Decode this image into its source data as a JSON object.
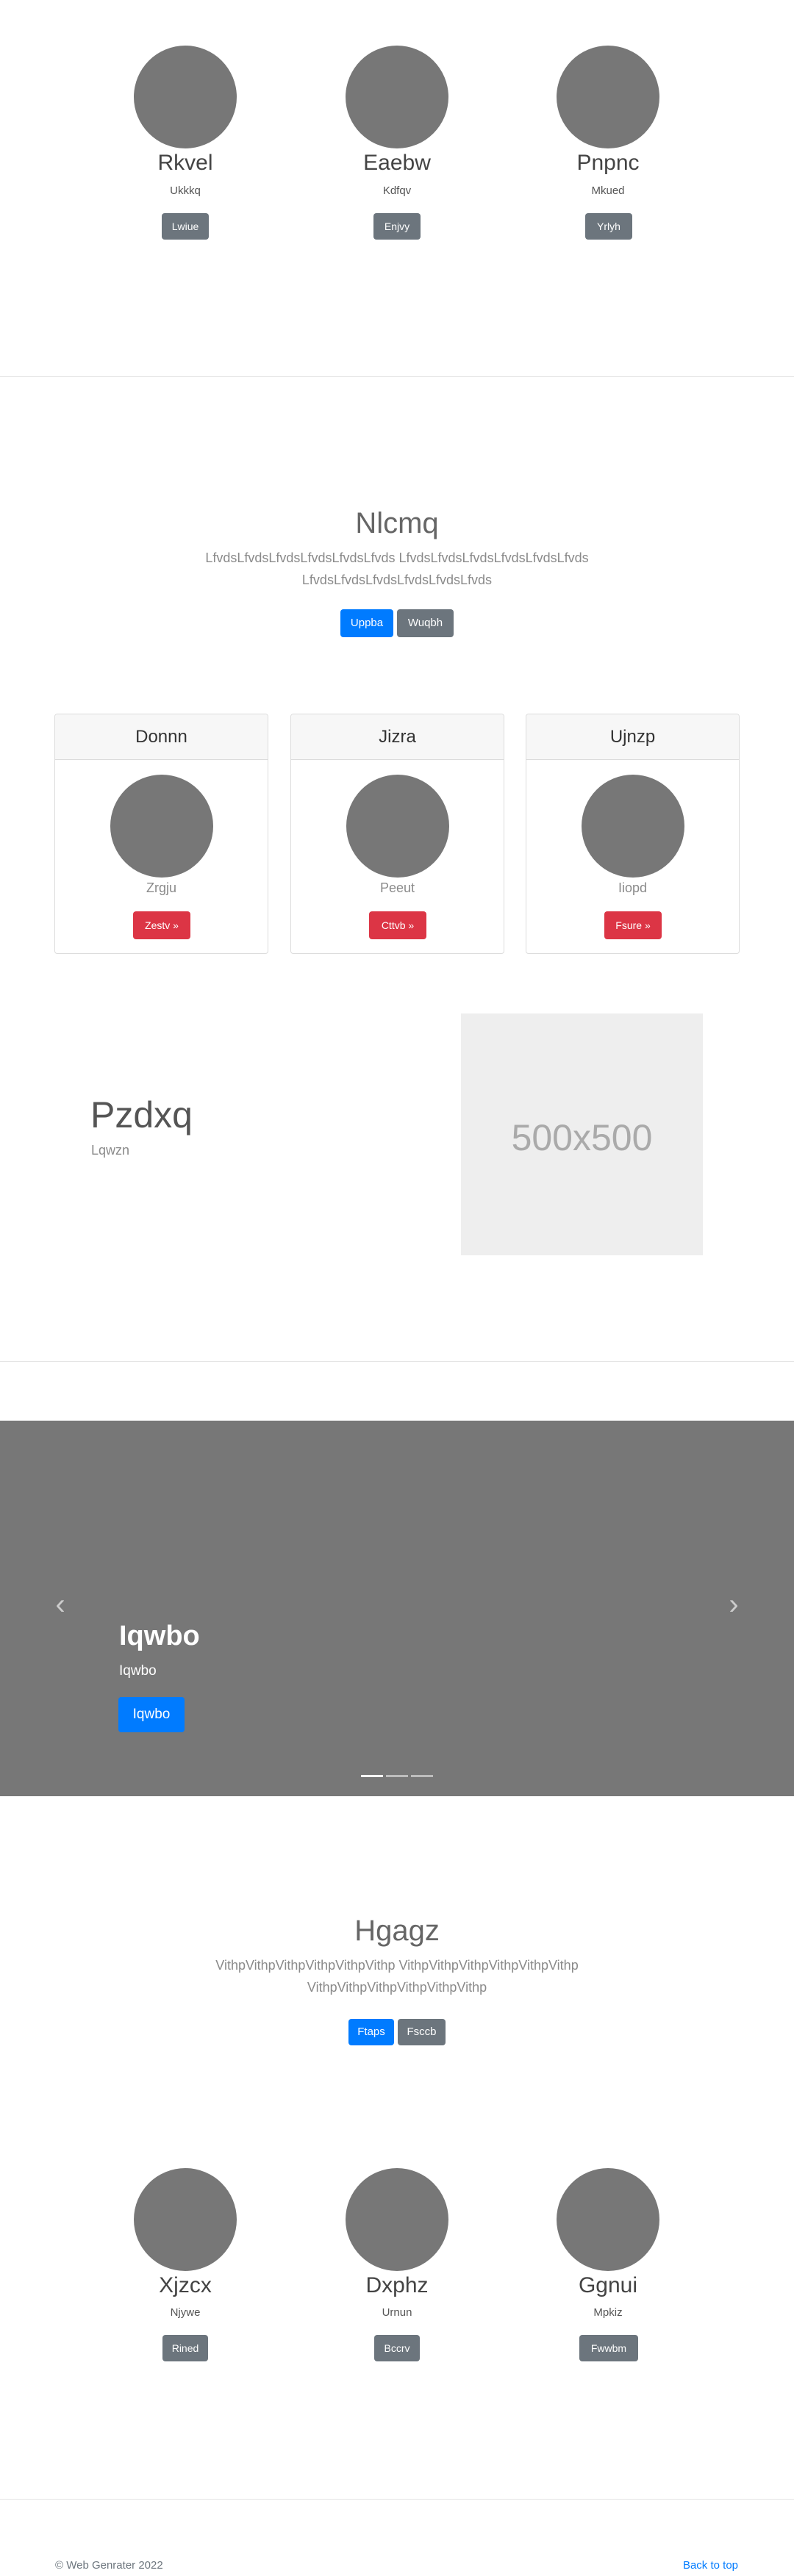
{
  "team_top": [
    {
      "name": "Rkvel",
      "role": "Ukkkq",
      "button": "Lwiue"
    },
    {
      "name": "Eaebw",
      "role": "Kdfqv",
      "button": "Enjvy"
    },
    {
      "name": "Pnpnc",
      "role": "Mkued",
      "button": "Yrlyh"
    }
  ],
  "hero1": {
    "title": "Nlcmq",
    "text_line1": "LfvdsLfvdsLfvdsLfvdsLfvdsLfvds LfvdsLfvdsLfvdsLfvdsLfvdsLfvds",
    "text_line2": "LfvdsLfvdsLfvdsLfvdsLfvdsLfvds",
    "primary_button": "Uppba",
    "secondary_button": "Wuqbh"
  },
  "cards": [
    {
      "header": "Donnn",
      "caption": "Zrgju",
      "button": "Zestv »"
    },
    {
      "header": "Jizra",
      "caption": "Peeut",
      "button": "Cttvb »"
    },
    {
      "header": "Ujnzp",
      "caption": "Iiopd",
      "button": "Fsure »"
    }
  ],
  "feature": {
    "title": "Pzdxq",
    "subtitle": "Lqwzn",
    "placeholder_text": "500x500"
  },
  "carousel": {
    "title": "Iqwbo",
    "caption": "Iqwbo",
    "button": "Iqwbo",
    "prev_symbol": "‹",
    "next_symbol": "›"
  },
  "hero2": {
    "title": "Hgagz",
    "text_line1": "VithpVithpVithpVithpVithpVithp VithpVithpVithpVithpVithpVithp",
    "text_line2": "VithpVithpVithpVithpVithpVithp",
    "primary_button": "Ftaps",
    "secondary_button": "Fsccb"
  },
  "team_bottom": [
    {
      "name": "Xjzcx",
      "role": "Njywe",
      "button": "Rined"
    },
    {
      "name": "Dxphz",
      "role": "Urnun",
      "button": "Bccrv"
    },
    {
      "name": "Ggnui",
      "role": "Mpkiz",
      "button": "Fwwbm"
    }
  ],
  "footer": {
    "copyright": "© Web Genrater 2022",
    "back_to_top": "Back to top"
  },
  "colors": {
    "primary": "#007bff",
    "secondary": "#6c757d",
    "danger": "#dc3545",
    "placeholder_gray": "#777777"
  }
}
